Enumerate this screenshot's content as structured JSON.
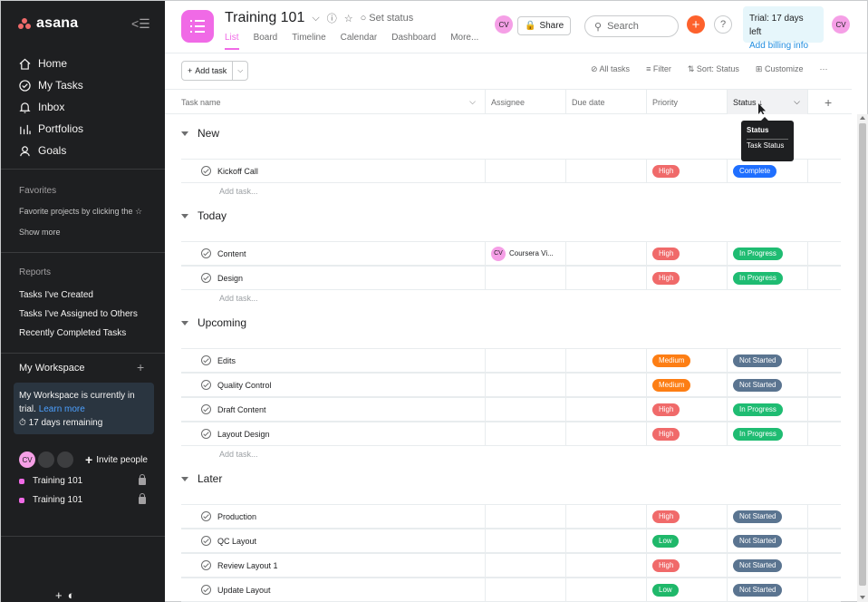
{
  "sidebar": {
    "logo": "asana",
    "nav": [
      {
        "label": "Home",
        "icon": "home-icon"
      },
      {
        "label": "My Tasks",
        "icon": "check-circle-icon"
      },
      {
        "label": "Inbox",
        "icon": "bell-icon"
      },
      {
        "label": "Portfolios",
        "icon": "bar-chart-icon"
      },
      {
        "label": "Goals",
        "icon": "person-icon"
      }
    ],
    "favorites_label": "Favorites",
    "favorites_hint": "Favorite projects by clicking the ☆",
    "show_more": "Show more",
    "reports_label": "Reports",
    "reports": [
      "Tasks I've Created",
      "Tasks I've Assigned to Others",
      "Recently Completed Tasks"
    ],
    "workspace_title": "My Workspace",
    "trial_text": "My Workspace is currently in trial.",
    "learn_more": "Learn more",
    "days_remaining": "17 days remaining",
    "avatar_initials": "CV",
    "invite": "Invite people",
    "projects": [
      "Training 101",
      "Training 101"
    ]
  },
  "header": {
    "project_title": "Training 101",
    "set_status": "Set status",
    "tabs": [
      "List",
      "Board",
      "Timeline",
      "Calendar",
      "Dashboard",
      "More..."
    ],
    "avatar_initials": "CV",
    "share": "Share",
    "search_placeholder": "Search",
    "trial_line": "Trial: 17 days left",
    "billing": "Add billing info",
    "user_initials": "CV"
  },
  "toolbar": {
    "add_task": "Add task",
    "all_tasks": "All tasks",
    "filter": "Filter",
    "sort": "Sort: Status",
    "customize": "Customize"
  },
  "columns": [
    "Task name",
    "Assignee",
    "Due date",
    "Priority",
    "Status"
  ],
  "tooltip": {
    "title": "Status",
    "item": "Task Status"
  },
  "add_task_row": "Add task...",
  "colors": {
    "high": "#f06a6a",
    "medium": "#fd7e14",
    "low": "#1fb86a",
    "complete": "#1f6fff",
    "in_progress": "#1fbc72",
    "not_started": "#5a7490",
    "brand": "#f06ae6"
  },
  "sections": [
    {
      "name": "New",
      "tasks": [
        {
          "name": "Kickoff Call",
          "assignee": "",
          "priority": "High",
          "status": "Complete"
        }
      ]
    },
    {
      "name": "Today",
      "tasks": [
        {
          "name": "Content",
          "assignee": "Coursera Vi...",
          "assignee_initials": "CV",
          "priority": "High",
          "status": "In Progress"
        },
        {
          "name": "Design",
          "assignee": "",
          "priority": "High",
          "status": "In Progress"
        }
      ]
    },
    {
      "name": "Upcoming",
      "tasks": [
        {
          "name": "Edits",
          "assignee": "",
          "priority": "Medium",
          "status": "Not Started"
        },
        {
          "name": "Quality Control",
          "assignee": "",
          "priority": "Medium",
          "status": "Not Started"
        },
        {
          "name": "Draft Content",
          "assignee": "",
          "priority": "High",
          "status": "In Progress"
        },
        {
          "name": "Layout Design",
          "assignee": "",
          "priority": "High",
          "status": "In Progress"
        }
      ]
    },
    {
      "name": "Later",
      "tasks": [
        {
          "name": "Production",
          "assignee": "",
          "priority": "High",
          "status": "Not Started"
        },
        {
          "name": "QC Layout",
          "assignee": "",
          "priority": "Low",
          "status": "Not Started"
        },
        {
          "name": "Review Layout 1",
          "assignee": "",
          "priority": "High",
          "status": "Not Started"
        },
        {
          "name": "Update Layout",
          "assignee": "",
          "priority": "Low",
          "status": "Not Started"
        }
      ]
    }
  ]
}
